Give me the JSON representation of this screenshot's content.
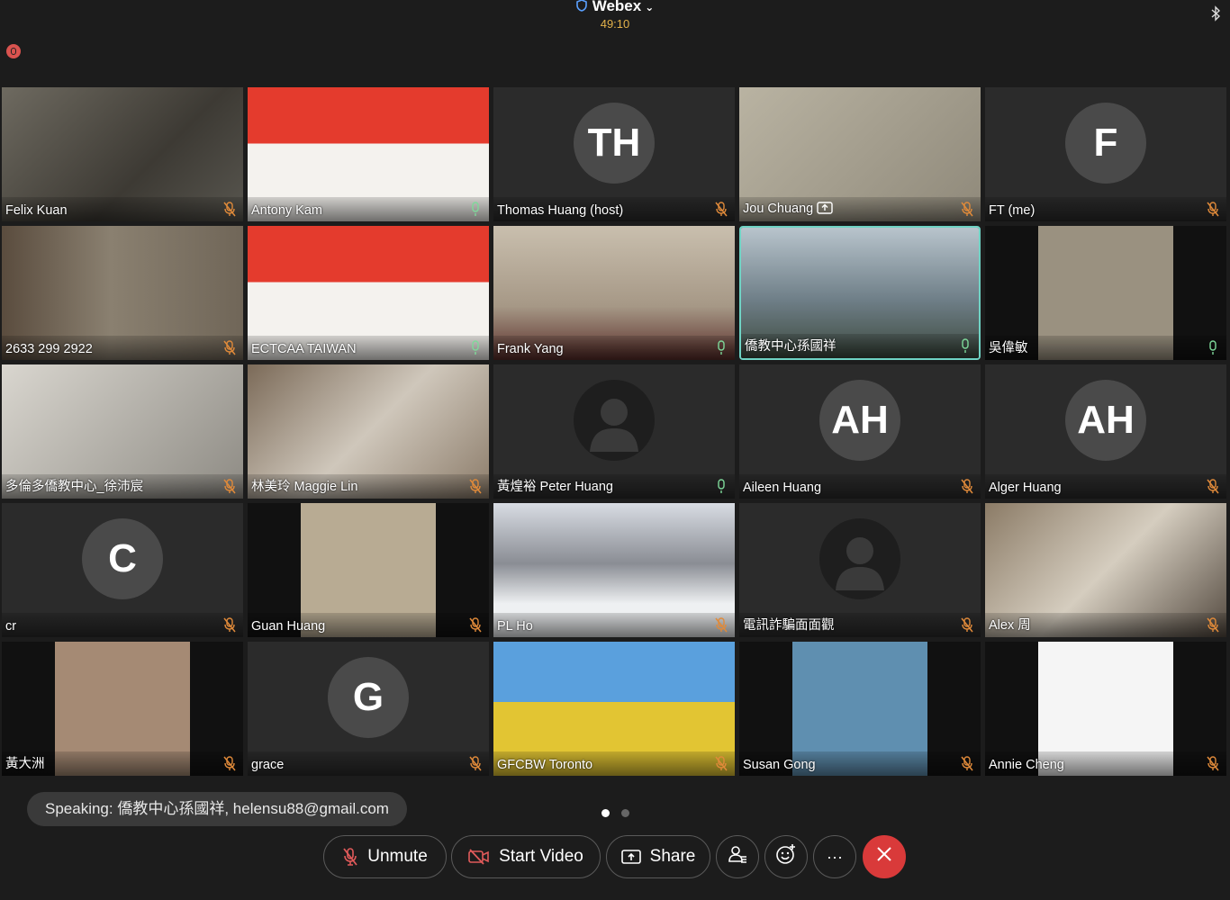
{
  "app": {
    "title": "Webex",
    "timer": "49:10"
  },
  "participants": [
    {
      "name": "Felix Kuan",
      "mic": "muted"
    },
    {
      "name": "Antony Kam",
      "mic": "on"
    },
    {
      "name": "Thomas Huang (host)",
      "mic": "muted",
      "initials": "TH"
    },
    {
      "name": "Jou Chuang",
      "mic": "muted",
      "sharing": true
    },
    {
      "name": "FT (me)",
      "mic": "muted",
      "initials": "F"
    },
    {
      "name": "2633 299 2922",
      "mic": "muted"
    },
    {
      "name": "ECTCAA TAIWAN",
      "mic": "on"
    },
    {
      "name": "Frank Yang",
      "mic": "on"
    },
    {
      "name": "僑教中心孫國祥",
      "mic": "on",
      "active": true
    },
    {
      "name": "吳偉敏",
      "mic": "on"
    },
    {
      "name": "多倫多僑教中心_徐沛宸",
      "mic": "muted"
    },
    {
      "name": "林美玲 Maggie Lin",
      "mic": "muted"
    },
    {
      "name": "黃煌裕 Peter Huang",
      "mic": "on"
    },
    {
      "name": "Aileen Huang",
      "mic": "muted",
      "initials": "AH"
    },
    {
      "name": "Alger Huang",
      "mic": "muted",
      "initials": "AH"
    },
    {
      "name": "cr",
      "mic": "muted",
      "initials": "C"
    },
    {
      "name": "Guan Huang",
      "mic": "muted"
    },
    {
      "name": "PL Ho",
      "mic": "muted"
    },
    {
      "name": "電訊詐騙面面觀",
      "mic": "muted"
    },
    {
      "name": "Alex 周",
      "mic": "muted"
    },
    {
      "name": "黃大洲",
      "mic": "muted"
    },
    {
      "name": "grace",
      "mic": "muted",
      "initials": "G"
    },
    {
      "name": "GFCBW Toronto",
      "mic": "muted"
    },
    {
      "name": "Susan Gong",
      "mic": "muted"
    },
    {
      "name": "Annie Cheng",
      "mic": "muted"
    }
  ],
  "banner": {
    "text": "Speaking: 僑教中心孫國祥, helensu88@gmail.com"
  },
  "pager": {
    "current": 1,
    "total": 2
  },
  "controls": {
    "unmute": "Unmute",
    "start_video": "Start Video",
    "share": "Share",
    "participants_icon": "participants-icon",
    "reactions_icon": "reactions-icon",
    "more": "···",
    "leave_icon": "close-icon"
  },
  "colors": {
    "accent_active": "#6fd3c4",
    "timer": "#e3b24a",
    "muted": "#e08a3a",
    "mic_on": "#7ed99a",
    "end": "#d93a3a"
  }
}
